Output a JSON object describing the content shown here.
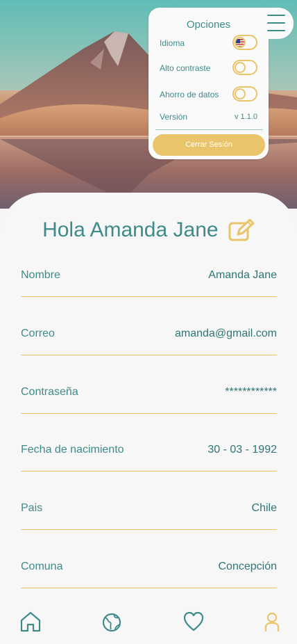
{
  "options": {
    "title": "Opciones",
    "items": [
      {
        "label": "Idioma",
        "toggle": "flag-us"
      },
      {
        "label": "Alto contraste",
        "toggle": "off"
      },
      {
        "label": "Ahorro de datos",
        "toggle": "off"
      }
    ],
    "version_label": "Versión",
    "version_value": "v 1.1.0",
    "logout_label": "Cerrar Sesión"
  },
  "profile": {
    "greeting": "Hola Amanda Jane",
    "fields": [
      {
        "label": "Nombre",
        "value": "Amanda Jane"
      },
      {
        "label": "Correo",
        "value": "amanda@gmail.com"
      },
      {
        "label": "Contraseña",
        "value": "************"
      },
      {
        "label": "Fecha de nacimiento",
        "value": "30 - 03 - 1992"
      },
      {
        "label": "Pais",
        "value": "Chile"
      },
      {
        "label": "Comuna",
        "value": "Concepción"
      }
    ]
  },
  "nav": {
    "items": [
      {
        "icon": "home-icon",
        "active": false
      },
      {
        "icon": "globe-icon",
        "active": false
      },
      {
        "icon": "heart-icon",
        "active": false
      },
      {
        "icon": "user-icon",
        "active": true
      }
    ]
  },
  "colors": {
    "primary": "#3e8b89",
    "accent": "#e9c46a",
    "background": "#f7f7f7"
  }
}
